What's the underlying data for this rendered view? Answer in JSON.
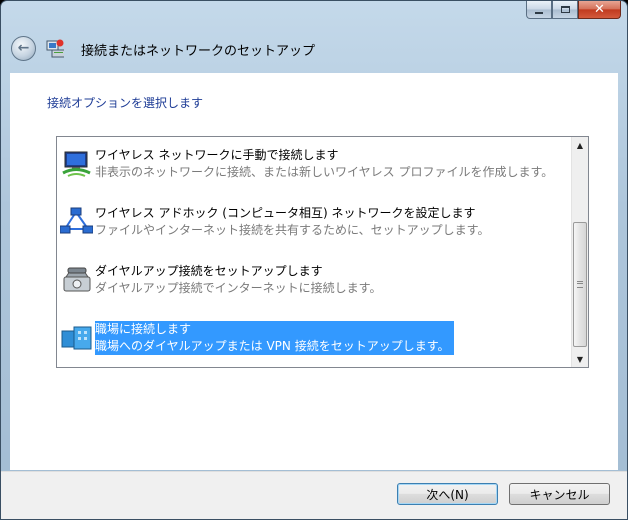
{
  "window": {
    "title": "接続またはネットワークのセットアップ"
  },
  "heading": "接続オプションを選択します",
  "options": [
    {
      "title": "ワイヤレス ネットワークに手動で接続します",
      "desc": "非表示のネットワークに接続、または新しいワイヤレス プロファイルを作成します。",
      "icon": "wireless-monitor-icon",
      "selected": false
    },
    {
      "title": "ワイヤレス アドホック (コンピュータ相互) ネットワークを設定します",
      "desc": "ファイルやインターネット接続を共有するために、セットアップします。",
      "icon": "adhoc-network-icon",
      "selected": false
    },
    {
      "title": "ダイヤルアップ接続をセットアップします",
      "desc": "ダイヤルアップ接続でインターネットに接続します。",
      "icon": "phone-icon",
      "selected": false
    },
    {
      "title": "職場に接続します",
      "desc": "職場へのダイヤルアップまたは VPN 接続をセットアップします。",
      "icon": "workplace-icon",
      "selected": true
    }
  ],
  "buttons": {
    "next": "次へ(N)",
    "cancel": "キャンセル"
  },
  "colors": {
    "heading": "#1e3c96",
    "selection": "#3399ff"
  }
}
